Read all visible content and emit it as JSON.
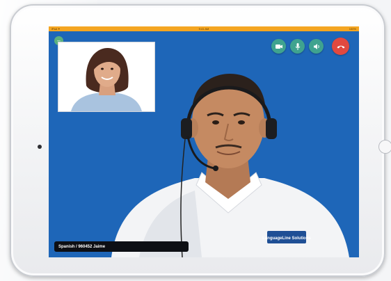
{
  "status_bar": {
    "left": "iPad ✦",
    "center": "9:41 AM",
    "right": "100%"
  },
  "call": {
    "caption": "Spanish / 960452 Jaime",
    "badge_text": "LanguageLine Solutions"
  },
  "controls": {
    "icons": [
      "video-camera-icon",
      "microphone-icon",
      "speaker-icon",
      "end-call-icon"
    ]
  },
  "colors": {
    "screen_background": "#1e66b8",
    "status_bar": "#f4a521",
    "control_button": "#3fa38f",
    "end_call_button": "#e2493f",
    "caption_background": "#0d0f14"
  }
}
